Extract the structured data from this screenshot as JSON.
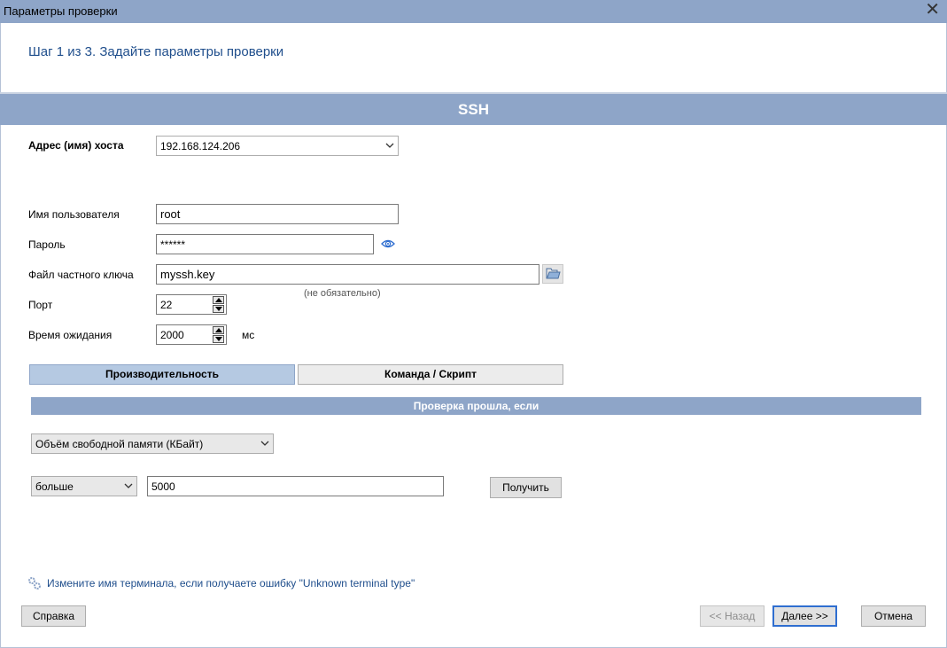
{
  "window": {
    "title": "Параметры проверки"
  },
  "step_header": "Шаг 1 из 3. Задайте параметры проверки",
  "section_title": "SSH",
  "host": {
    "label": "Адрес (имя) хоста",
    "value": "192.168.124.206"
  },
  "username": {
    "label": "Имя пользователя",
    "value": "root"
  },
  "password": {
    "label": "Пароль",
    "value": "******"
  },
  "key_file": {
    "label": "Файл частного ключа",
    "value": "myssh.key",
    "note": "(не обязательно)"
  },
  "port": {
    "label": "Порт",
    "value": "22"
  },
  "timeout": {
    "label": "Время ожидания",
    "value": "2000",
    "unit": "мс"
  },
  "tabs": [
    {
      "label": "Производительность",
      "active": true
    },
    {
      "label": "Команда / Скрипт",
      "active": false
    }
  ],
  "check_header": "Проверка прошла, если",
  "metric_select": {
    "value": "Объём свободной памяти (КБайт)"
  },
  "condition": {
    "operator": "больше",
    "value": "5000",
    "get_button": "Получить"
  },
  "hint_link": "Измените имя терминала, если получаете ошибку \"Unknown terminal type\"",
  "buttons": {
    "help": "Справка",
    "back": "<< Назад",
    "next": "Далее >>",
    "cancel": "Отмена"
  },
  "colors": {
    "accent_bar": "#8ea5c8",
    "link": "#1f4e8c",
    "default_button_border": "#2f6ed0"
  }
}
